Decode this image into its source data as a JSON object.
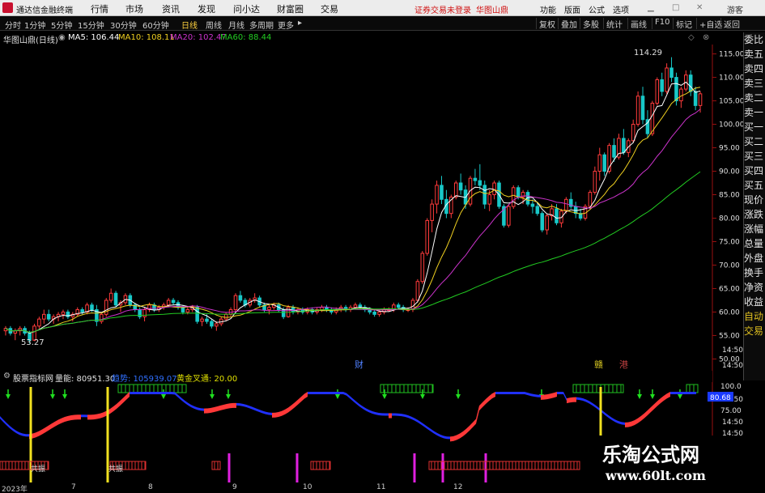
{
  "app": {
    "title": "通达信金融终端",
    "menus": [
      "行情",
      "市场",
      "资讯",
      "发现",
      "问小达",
      "财富圈",
      "交易"
    ],
    "warning": "证券交易未登录",
    "stock_name_top": "华图山鼎",
    "right_menus": [
      "功能",
      "版面",
      "公式",
      "选项"
    ],
    "guest_label": "游客"
  },
  "toolbar": {
    "timeframes": [
      "分时",
      "1分钟",
      "5分钟",
      "15分钟",
      "30分钟",
      "60分钟",
      "日线",
      "周线",
      "月线",
      "多周期",
      "更多"
    ],
    "active_timeframe": "日线",
    "buttons": [
      "复权",
      "叠加",
      "多股",
      "统计",
      "画线",
      "F10",
      "标记",
      "+自选",
      "返回"
    ]
  },
  "chart": {
    "title": "华图山鼎(日线)",
    "ma5": "MA5: 106.44",
    "ma10": "MA10: 108.11",
    "ma20": "MA20: 102.47",
    "ma60": "MA60: 88.44",
    "high_label": "114.29",
    "low_label": "53.27",
    "price_ticks": [
      "115.00",
      "110.00",
      "105.00",
      "100.00",
      "95.00",
      "90.00",
      "85.00",
      "80.00",
      "75.00",
      "70.00",
      "65.00",
      "60.00",
      "55.00",
      "50.00"
    ],
    "time_ticks": [
      "14:50",
      "14:50"
    ],
    "event_labels": [
      "财",
      "赣",
      "港"
    ],
    "colors": {
      "up": "#ff3b3b",
      "down": "#18c8c8",
      "ma5": "#ffffff",
      "ma10": "#f0d020",
      "ma20": "#cc33cc",
      "ma60": "#22cc22"
    },
    "chart_data": {
      "type": "candlestick",
      "ohlc": [
        [
          56.0,
          57.0,
          55.0,
          56.5
        ],
        [
          56.5,
          57.0,
          55.0,
          55.5
        ],
        [
          55.5,
          56.5,
          54.0,
          56.0
        ],
        [
          56.0,
          57.0,
          55.0,
          56.5
        ],
        [
          56.5,
          57.0,
          55.0,
          55.5
        ],
        [
          55.5,
          56.0,
          53.3,
          54.0
        ],
        [
          54.0,
          57.5,
          53.8,
          57.0
        ],
        [
          57.0,
          59.0,
          56.5,
          58.5
        ],
        [
          58.5,
          60.5,
          57.5,
          59.5
        ],
        [
          59.5,
          60.5,
          58.0,
          58.5
        ],
        [
          58.5,
          59.5,
          57.5,
          59.0
        ],
        [
          59.0,
          60.0,
          58.0,
          59.5
        ],
        [
          59.5,
          60.5,
          58.5,
          60.0
        ],
        [
          60.0,
          60.5,
          58.5,
          59.0
        ],
        [
          59.0,
          60.0,
          58.0,
          59.5
        ],
        [
          59.5,
          61.0,
          59.0,
          60.5
        ],
        [
          60.5,
          61.0,
          59.5,
          60.0
        ],
        [
          60.0,
          62.0,
          59.5,
          61.5
        ],
        [
          61.5,
          62.0,
          60.0,
          60.5
        ],
        [
          60.5,
          61.5,
          57.0,
          58.0
        ],
        [
          58.0,
          60.0,
          57.5,
          59.5
        ],
        [
          59.5,
          63.0,
          59.0,
          62.5
        ],
        [
          62.5,
          65.0,
          62.0,
          64.0
        ],
        [
          64.0,
          64.5,
          61.0,
          61.5
        ],
        [
          61.5,
          62.5,
          60.0,
          62.0
        ],
        [
          62.0,
          64.0,
          61.5,
          63.5
        ],
        [
          63.5,
          64.0,
          61.0,
          61.5
        ],
        [
          61.5,
          62.0,
          60.0,
          60.5
        ],
        [
          60.5,
          61.0,
          58.5,
          59.0
        ],
        [
          59.0,
          61.0,
          58.0,
          60.5
        ],
        [
          60.5,
          62.0,
          60.0,
          61.5
        ],
        [
          61.5,
          62.0,
          60.0,
          60.5
        ],
        [
          60.5,
          61.5,
          60.0,
          61.0
        ],
        [
          61.0,
          62.0,
          60.5,
          61.5
        ],
        [
          61.5,
          63.0,
          61.0,
          62.5
        ],
        [
          62.5,
          63.0,
          61.5,
          62.0
        ],
        [
          62.0,
          62.5,
          60.5,
          61.0
        ],
        [
          61.0,
          61.5,
          59.5,
          60.0
        ],
        [
          60.0,
          61.0,
          59.5,
          60.5
        ],
        [
          60.5,
          61.5,
          60.0,
          61.0
        ],
        [
          61.0,
          61.5,
          57.5,
          58.0
        ],
        [
          58.0,
          59.0,
          57.0,
          58.5
        ],
        [
          58.5,
          59.5,
          57.5,
          58.0
        ],
        [
          58.0,
          58.5,
          56.5,
          57.0
        ],
        [
          57.0,
          58.0,
          56.0,
          57.5
        ],
        [
          57.5,
          59.0,
          57.0,
          58.5
        ],
        [
          58.5,
          60.0,
          58.0,
          59.5
        ],
        [
          59.5,
          61.0,
          59.0,
          60.5
        ],
        [
          60.5,
          64.0,
          60.0,
          63.5
        ],
        [
          63.5,
          64.5,
          62.0,
          62.5
        ],
        [
          62.5,
          63.0,
          61.0,
          61.5
        ],
        [
          61.5,
          63.0,
          61.0,
          62.5
        ],
        [
          62.5,
          64.0,
          62.0,
          63.0
        ],
        [
          63.0,
          63.5,
          61.0,
          61.5
        ],
        [
          61.5,
          62.0,
          60.0,
          60.5
        ],
        [
          60.5,
          61.5,
          59.5,
          61.0
        ],
        [
          61.0,
          62.0,
          60.5,
          61.5
        ],
        [
          61.5,
          62.0,
          60.0,
          60.5
        ],
        [
          60.5,
          61.0,
          58.5,
          59.0
        ],
        [
          59.0,
          61.5,
          58.8,
          61.0
        ],
        [
          61.0,
          61.5,
          59.5,
          60.0
        ],
        [
          60.0,
          61.0,
          59.5,
          60.5
        ],
        [
          60.5,
          61.0,
          59.5,
          60.0
        ],
        [
          60.0,
          61.0,
          59.5,
          60.5
        ],
        [
          60.5,
          61.0,
          59.5,
          60.0
        ],
        [
          60.0,
          61.0,
          59.5,
          60.5
        ],
        [
          60.5,
          61.5,
          60.0,
          61.0
        ],
        [
          61.0,
          61.5,
          60.0,
          60.5
        ],
        [
          60.5,
          61.0,
          59.5,
          60.0
        ],
        [
          60.0,
          61.0,
          59.5,
          60.5
        ],
        [
          60.5,
          61.5,
          60.0,
          61.0
        ],
        [
          61.0,
          61.5,
          60.0,
          60.5
        ],
        [
          60.5,
          61.5,
          60.0,
          61.0
        ],
        [
          61.0,
          62.0,
          60.5,
          61.5
        ],
        [
          61.5,
          62.0,
          60.5,
          61.0
        ],
        [
          61.0,
          61.5,
          60.0,
          60.5
        ],
        [
          60.5,
          61.0,
          59.5,
          60.0
        ],
        [
          60.0,
          60.5,
          59.0,
          59.5
        ],
        [
          59.5,
          60.5,
          59.0,
          60.0
        ],
        [
          60.0,
          61.0,
          59.5,
          60.5
        ],
        [
          60.5,
          61.0,
          60.0,
          60.5
        ],
        [
          60.5,
          62.0,
          60.0,
          61.5
        ],
        [
          61.5,
          62.0,
          60.5,
          61.0
        ],
        [
          61.0,
          61.5,
          60.0,
          60.5
        ],
        [
          60.5,
          61.0,
          60.0,
          60.5
        ],
        [
          60.5,
          63.0,
          60.0,
          62.5
        ],
        [
          62.5,
          67.0,
          62.0,
          66.5
        ],
        [
          66.5,
          73.0,
          66.0,
          72.5
        ],
        [
          72.5,
          80.0,
          72.0,
          79.5
        ],
        [
          79.5,
          84.0,
          77.0,
          83.0
        ],
        [
          83.0,
          88.0,
          81.0,
          87.0
        ],
        [
          87.0,
          89.0,
          83.0,
          84.0
        ],
        [
          84.0,
          86.0,
          80.0,
          81.0
        ],
        [
          81.0,
          85.0,
          80.0,
          84.5
        ],
        [
          84.5,
          88.0,
          84.0,
          87.5
        ],
        [
          87.5,
          89.5,
          85.0,
          86.0
        ],
        [
          86.0,
          87.0,
          82.0,
          83.0
        ],
        [
          83.0,
          89.0,
          82.5,
          88.5
        ],
        [
          88.5,
          90.5,
          87.0,
          88.0
        ],
        [
          88.0,
          91.5,
          86.0,
          87.0
        ],
        [
          87.0,
          88.0,
          82.0,
          83.0
        ],
        [
          83.0,
          86.0,
          81.5,
          85.0
        ],
        [
          85.0,
          88.0,
          84.0,
          87.5
        ],
        [
          87.5,
          88.0,
          82.0,
          82.5
        ],
        [
          82.5,
          83.0,
          78.0,
          78.5
        ],
        [
          78.5,
          83.0,
          78.0,
          82.5
        ],
        [
          82.5,
          87.0,
          82.0,
          86.5
        ],
        [
          86.5,
          87.0,
          84.0,
          84.5
        ],
        [
          84.5,
          86.0,
          83.0,
          85.5
        ],
        [
          85.5,
          86.0,
          82.5,
          83.0
        ],
        [
          83.0,
          84.0,
          81.0,
          82.5
        ],
        [
          82.5,
          83.5,
          80.5,
          81.0
        ],
        [
          81.0,
          81.5,
          77.0,
          77.5
        ],
        [
          77.5,
          81.0,
          76.5,
          80.5
        ],
        [
          80.5,
          83.0,
          79.5,
          82.0
        ],
        [
          82.0,
          83.0,
          78.5,
          79.0
        ],
        [
          79.0,
          82.0,
          78.0,
          81.5
        ],
        [
          81.5,
          84.5,
          81.0,
          84.0
        ],
        [
          84.0,
          85.5,
          82.0,
          82.5
        ],
        [
          82.5,
          83.5,
          80.0,
          81.0
        ],
        [
          81.0,
          82.0,
          79.5,
          80.0
        ],
        [
          80.0,
          83.0,
          79.5,
          82.5
        ],
        [
          82.5,
          86.0,
          82.0,
          85.5
        ],
        [
          85.5,
          91.0,
          85.0,
          90.0
        ],
        [
          90.0,
          95.0,
          88.0,
          93.5
        ],
        [
          93.5,
          94.0,
          89.0,
          90.0
        ],
        [
          90.0,
          96.0,
          89.5,
          95.5
        ],
        [
          95.5,
          97.0,
          92.0,
          93.0
        ],
        [
          93.0,
          98.0,
          92.5,
          97.0
        ],
        [
          97.0,
          99.0,
          93.5,
          94.0
        ],
        [
          94.0,
          97.0,
          93.0,
          96.5
        ],
        [
          96.5,
          101.0,
          96.0,
          100.0
        ],
        [
          100.0,
          107.0,
          99.5,
          106.0
        ],
        [
          106.0,
          108.0,
          100.0,
          101.0
        ],
        [
          101.0,
          103.0,
          97.0,
          98.0
        ],
        [
          98.0,
          105.0,
          97.5,
          104.5
        ],
        [
          104.5,
          110.0,
          104.0,
          109.5
        ],
        [
          109.5,
          111.0,
          106.0,
          107.0
        ],
        [
          107.0,
          113.0,
          106.5,
          112.0
        ],
        [
          112.0,
          114.3,
          109.0,
          110.0
        ],
        [
          110.0,
          111.0,
          104.0,
          105.0
        ],
        [
          105.0,
          108.0,
          103.5,
          107.5
        ],
        [
          107.5,
          111.5,
          107.0,
          110.5
        ],
        [
          110.5,
          111.5,
          106.0,
          107.0
        ],
        [
          107.0,
          108.0,
          103.0,
          104.0
        ],
        [
          104.0,
          107.0,
          102.5,
          106.5
        ]
      ]
    },
    "y_range": [
      48,
      117
    ]
  },
  "indicator": {
    "title": "股票指标网",
    "liangneng": "量能: 80951.30",
    "qushi": "趋势: 105939.07",
    "huangjin": "黄金叉通: 20.00",
    "ticks": [
      "100.0",
      "14:50",
      "75.00",
      "14:50",
      "14:50"
    ],
    "value_badge": "80.68",
    "gongzhen": "共振"
  },
  "xaxis": [
    "2023年",
    "7",
    "8",
    "9",
    "10",
    "11",
    "12"
  ],
  "right_panel": [
    "委比",
    "卖五",
    "卖四",
    "卖三",
    "卖二",
    "卖一",
    "买一",
    "买二",
    "买三",
    "买四",
    "买五",
    "现价",
    "涨跌",
    "涨幅",
    "总量",
    "外盘",
    "换手",
    "净资",
    "收益",
    "自动",
    "交易"
  ],
  "watermark": {
    "line1": "乐淘公式网",
    "line2": "www.60lt.com"
  }
}
